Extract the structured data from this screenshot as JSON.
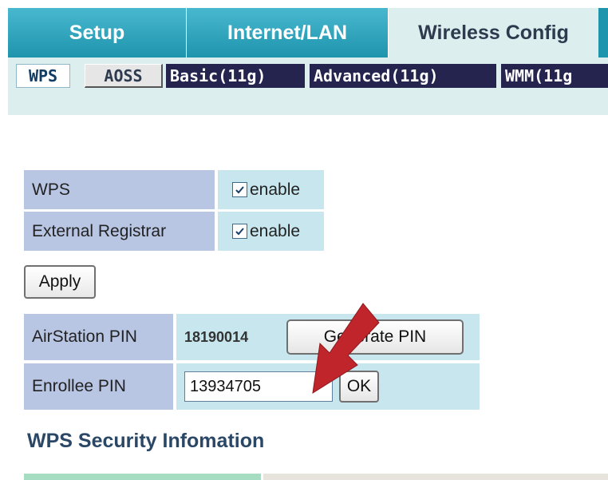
{
  "main_tabs": [
    {
      "label": "Setup"
    },
    {
      "label": "Internet/LAN"
    },
    {
      "label": "Wireless Config",
      "active": true
    }
  ],
  "sub_tabs": [
    {
      "label": "WPS",
      "active": true
    },
    {
      "label": "AOSS"
    },
    {
      "label": "Basic(11g)"
    },
    {
      "label": "Advanced(11g)"
    },
    {
      "label": "WMM(11g"
    }
  ],
  "settings": {
    "wps": {
      "label": "WPS",
      "checked": true,
      "checkbox_label": "enable"
    },
    "external_registrar": {
      "label": "External Registrar",
      "checked": true,
      "checkbox_label": "enable"
    }
  },
  "apply_label": "Apply",
  "pins": {
    "airstation": {
      "label": "AirStation PIN",
      "value": "18190014",
      "button": "Generate PIN"
    },
    "enrollee": {
      "label": "Enrollee PIN",
      "value": "13934705",
      "button": "OK"
    }
  },
  "section_title": "WPS Security Infomation",
  "colors": {
    "tab_teal": "#1f94ad",
    "tab_active_bg": "#ddeeef",
    "label_cell": "#b8c6e4",
    "value_cell": "#c7e6ee",
    "sub_tab_dark": "#24244e",
    "annotation_arrow": "#c0252b",
    "heading": "#2b4766"
  },
  "icons": {
    "checkbox": "check-mark",
    "annotation": "red-pointer-arrow"
  }
}
